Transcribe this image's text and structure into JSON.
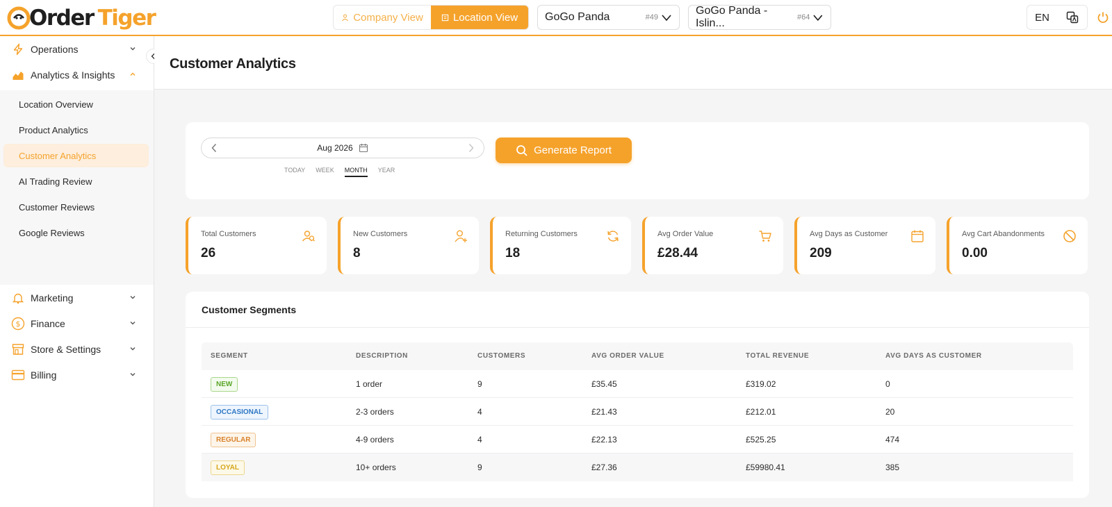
{
  "app": {
    "logo_part1": "Order",
    "logo_part2": "Tiger"
  },
  "header": {
    "company_view": "Company View",
    "location_view": "Location View",
    "company_select": {
      "value": "GoGo Panda",
      "id": "#49"
    },
    "location_select": {
      "value": "GoGo Panda - Islin...",
      "id": "#64"
    },
    "language": "EN"
  },
  "sidebar": {
    "items": [
      {
        "label": "Operations",
        "icon": "bolt-icon",
        "expanded": false
      },
      {
        "label": "Analytics & Insights",
        "icon": "chart-icon",
        "expanded": true
      },
      {
        "label": "Marketing",
        "icon": "bell-icon",
        "expanded": false
      },
      {
        "label": "Finance",
        "icon": "dollar-icon",
        "expanded": false
      },
      {
        "label": "Store & Settings",
        "icon": "store-icon",
        "expanded": false
      },
      {
        "label": "Billing",
        "icon": "card-icon",
        "expanded": false
      }
    ],
    "analytics_sub": [
      {
        "label": "Location Overview",
        "active": false
      },
      {
        "label": "Product Analytics",
        "active": false
      },
      {
        "label": "Customer Analytics",
        "active": true
      },
      {
        "label": "AI Trading Review",
        "active": false
      },
      {
        "label": "Customer Reviews",
        "active": false
      },
      {
        "label": "Google Reviews",
        "active": false
      }
    ]
  },
  "page": {
    "title": "Customer Analytics"
  },
  "report": {
    "date_label": "Aug 2026",
    "periods": [
      "TODAY",
      "WEEK",
      "MONTH",
      "YEAR"
    ],
    "active_period": "MONTH",
    "generate_label": "Generate Report"
  },
  "metrics": [
    {
      "label": "Total Customers",
      "value": "26",
      "icon": "users-icon"
    },
    {
      "label": "New Customers",
      "value": "8",
      "icon": "user-plus-icon"
    },
    {
      "label": "Returning Customers",
      "value": "18",
      "icon": "refresh-icon"
    },
    {
      "label": "Avg Order Value",
      "value": "£28.44",
      "icon": "cart-icon"
    },
    {
      "label": "Avg Days as Customer",
      "value": "209",
      "icon": "calendar-icon"
    },
    {
      "label": "Avg Cart Abandonments",
      "value": "0.00",
      "icon": "block-icon"
    }
  ],
  "segments": {
    "title": "Customer Segments",
    "columns": [
      "SEGMENT",
      "DESCRIPTION",
      "CUSTOMERS",
      "AVG ORDER VALUE",
      "TOTAL REVENUE",
      "AVG DAYS AS CUSTOMER"
    ],
    "rows": [
      {
        "segment": "NEW",
        "description": "1 order",
        "customers": "9",
        "avg_order": "£35.45",
        "revenue": "£319.02",
        "days": "0"
      },
      {
        "segment": "OCCASIONAL",
        "description": "2-3 orders",
        "customers": "4",
        "avg_order": "£21.43",
        "revenue": "£212.01",
        "days": "20"
      },
      {
        "segment": "REGULAR",
        "description": "4-9 orders",
        "customers": "4",
        "avg_order": "£22.13",
        "revenue": "£525.25",
        "days": "474"
      },
      {
        "segment": "LOYAL",
        "description": "10+ orders",
        "customers": "9",
        "avg_order": "£27.36",
        "revenue": "£59980.41",
        "days": "385"
      }
    ]
  },
  "colors": {
    "accent": "#f5a22b",
    "new_badge": "#5aa629",
    "occasional_badge": "#2e77c4",
    "regular_badge": "#d9822b",
    "loyal_badge": "#d6a619"
  }
}
